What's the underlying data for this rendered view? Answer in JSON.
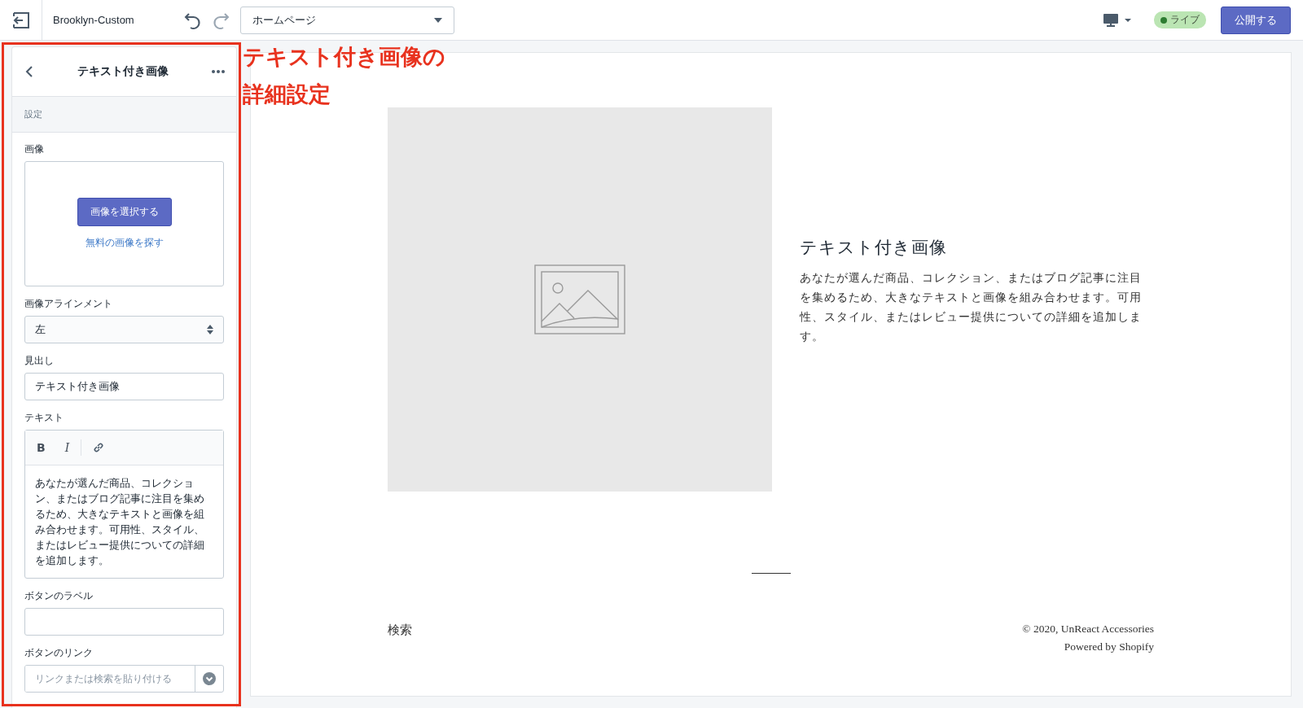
{
  "topbar": {
    "theme_name": "Brooklyn-Custom",
    "page_select": "ホームページ",
    "status": {
      "label": "ライブ",
      "color": "#2e7d32"
    },
    "publish_button": "公開する"
  },
  "sidebar": {
    "title": "テキスト付き画像",
    "section": "設定",
    "fields": [
      {
        "kind": "image",
        "label": "画像",
        "button": "画像を選択する",
        "link": "無料の画像を探す"
      },
      {
        "kind": "select",
        "label": "画像アラインメント",
        "value": "左"
      },
      {
        "kind": "text",
        "label": "見出し",
        "value": "テキスト付き画像"
      },
      {
        "kind": "richtext",
        "label": "テキスト",
        "tools": [
          "B",
          "I"
        ],
        "value": "あなたが選んだ商品、コレクション、またはブログ記事に注目を集めるため、大きなテキストと画像を組み合わせます。可用性、スタイル、またはレビュー提供についての詳細を追加します。"
      },
      {
        "kind": "text",
        "label": "ボタンのラベル"
      },
      {
        "kind": "link",
        "label": "ボタンのリンク",
        "placeholder": "リンクまたは検索を貼り付ける"
      }
    ]
  },
  "annotation": {
    "lines": [
      "テキスト付き画像の",
      "詳細設定"
    ]
  },
  "preview": {
    "heading": "テキスト付き画像",
    "body": "あなたが選んだ商品、コレクション、またはブログ記事に注目を集めるため、大きなテキストと画像を組み合わせます。可用性、スタイル、またはレビュー提供についての詳細を追加します。",
    "footer_link": "検索",
    "copyright": "© 2020, UnReact Accessories",
    "powered": "Powered by Shopify"
  }
}
